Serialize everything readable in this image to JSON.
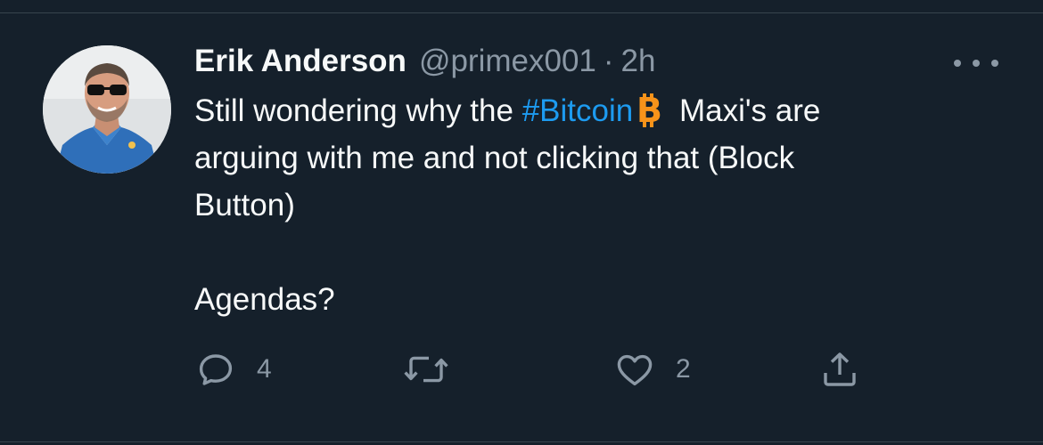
{
  "tweet": {
    "author_name": "Erik Anderson",
    "handle": "@primex001",
    "separator": "·",
    "time": "2h",
    "text_line1_before": "Still wondering why the ",
    "hashtag": "#Bitcoin",
    "text_line1_after": " Maxi's are",
    "text_line2": "arguing with me and not clicking that (Block",
    "text_line3": "Button)",
    "text_line5": "Agendas?",
    "emoji": "bitcoin-emoji"
  },
  "actions": {
    "reply_count": "4",
    "like_count": "2"
  },
  "colors": {
    "background": "#15202b",
    "text": "#f7f9f9",
    "secondary": "#8b98a5",
    "link": "#1d9bf0",
    "bitcoin": "#f7931a"
  },
  "icons": [
    "more-icon",
    "reply-icon",
    "retweet-icon",
    "like-icon",
    "share-icon",
    "bitcoin-emoji"
  ]
}
